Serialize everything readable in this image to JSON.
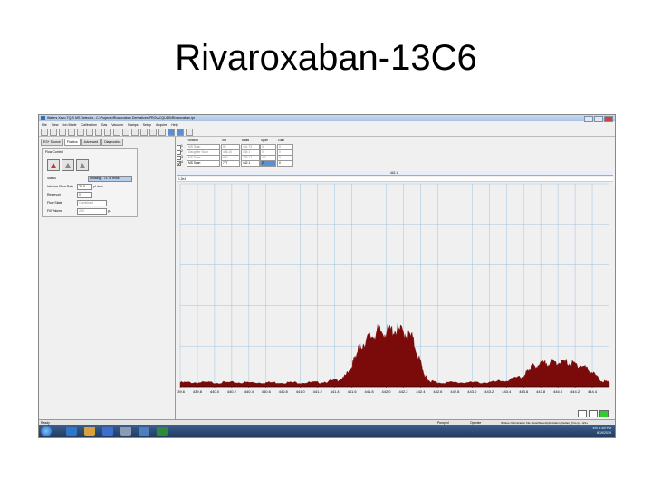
{
  "slide": {
    "title": "Rivaroxaban-13C6"
  },
  "window": {
    "title": "Waters Xevo TQ-S MS Detector - C:\\Projects\\Rivaroxaban Derivatives.PRO\\ACQUDB\\Rivaroxaban.ipr"
  },
  "menu": [
    "File",
    "View",
    "Ion Mode",
    "Calibration",
    "Gas",
    "Vacuum",
    "Ramps",
    "Setup",
    "Acquire",
    "Help"
  ],
  "left_panel": {
    "tabs": [
      "ES+ Source",
      "Fluidics",
      "Advanced",
      "Diagnostics"
    ],
    "active_tab": "Fluidics",
    "group_label": "Flow Control",
    "fields": [
      {
        "label": "Status",
        "value": "Infusing - 73.73 mins",
        "unit": ""
      },
      {
        "label": "Infusion Flow Rate",
        "value": "20.0",
        "unit": "µL/min"
      },
      {
        "label": "Reservoir",
        "value": "B",
        "unit": ""
      },
      {
        "label": "Flow State",
        "value": "Combined",
        "unit": ""
      },
      {
        "label": "Fill Volume",
        "value": "250",
        "unit": "µL"
      }
    ]
  },
  "function_table": {
    "headers": [
      "Function",
      "Set",
      "Mass",
      "Span",
      "Gain"
    ],
    "rows": [
      {
        "index": "1",
        "function": "MS Scan",
        "set": "50",
        "mass": "441.73",
        "span": "0",
        "gain": "0",
        "active": false
      },
      {
        "index": "2",
        "function": "Daughter Scan",
        "set": "436.10",
        "mass": "145.1",
        "span": "0",
        "gain": "0",
        "active": false
      },
      {
        "index": "3",
        "function": "MS Scan",
        "set": "800",
        "mass": "235.17",
        "span": "0.0",
        "gain": "0",
        "active": false
      },
      {
        "index": "4",
        "function": "MS Scan",
        "set": "777",
        "mass": "442.1",
        "span": "2",
        "gain": "0",
        "active": true
      }
    ]
  },
  "spectrum": {
    "header_mass": "442.1",
    "range_label": "1.2e4"
  },
  "chart_data": {
    "type": "area",
    "xlabel": "",
    "ylabel": "",
    "xlim": [
      439.6,
      444.6
    ],
    "ylim": [
      0,
      1
    ],
    "tick_labels": [
      "439.6",
      "439.8",
      "440.0",
      "440.2",
      "440.4",
      "440.6",
      "440.8",
      "441.0",
      "441.2",
      "441.4",
      "441.6",
      "441.8",
      "442.0",
      "442.2",
      "442.4",
      "442.6",
      "442.8",
      "443.0",
      "443.2",
      "443.4",
      "443.6",
      "443.8",
      "444.0",
      "444.2",
      "444.4"
    ],
    "x": [
      439.6,
      439.8,
      440.0,
      440.2,
      440.4,
      440.6,
      440.8,
      441.0,
      441.2,
      441.4,
      441.5,
      441.6,
      441.65,
      441.7,
      441.8,
      441.9,
      442.0,
      442.1,
      442.2,
      442.3,
      442.4,
      442.45,
      442.5,
      442.6,
      442.8,
      443.0,
      443.2,
      443.4,
      443.6,
      443.65,
      443.7,
      443.8,
      443.9,
      444.0,
      444.1,
      444.2,
      444.3,
      444.4,
      444.5,
      444.6
    ],
    "y": [
      0.02,
      0.02,
      0.02,
      0.02,
      0.02,
      0.02,
      0.02,
      0.02,
      0.02,
      0.03,
      0.04,
      0.1,
      0.16,
      0.2,
      0.24,
      0.27,
      0.27,
      0.28,
      0.27,
      0.24,
      0.12,
      0.05,
      0.03,
      0.02,
      0.02,
      0.02,
      0.02,
      0.03,
      0.05,
      0.08,
      0.1,
      0.11,
      0.12,
      0.12,
      0.12,
      0.11,
      0.1,
      0.07,
      0.03,
      0.02
    ],
    "fill_color": "#7b0a0a",
    "grid": true
  },
  "status_bar": {
    "left": "Ready",
    "pumped": "Pumped",
    "operate": "Operate",
    "file": "IDVave Optimization File: ScanWaveOptimization_Default_Pos.ipr - ES+"
  },
  "taskbar": {
    "tray_lang": "EN",
    "time": "1:59 PM",
    "date": "8/19/2019"
  },
  "colors": {
    "accent": "#2ecc2e",
    "spectrum": "#7b0a0a"
  }
}
